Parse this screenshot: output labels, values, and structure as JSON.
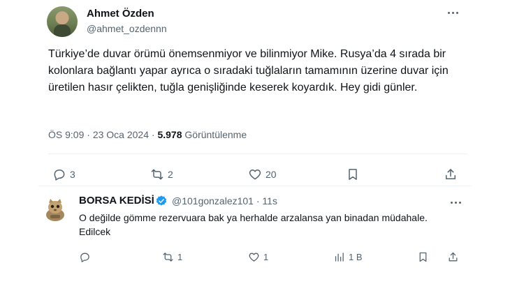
{
  "tweet": {
    "author_name": "Ahmet Özden",
    "author_handle": "@ahmet_ozdennn",
    "text": "Türkiye’de duvar örümü önemsenmiyor ve bilinmiyor Mike. Rusya’da 4 sırada bir kolonlara bağlantı yapar ayrıca o sıradaki tuğlaların tamamının üzerine duvar için üretilen hasır çelikten, tuğla genişliğinde keserek koyardık. Hey gidi günler.",
    "time": "ÖS 9:09",
    "separator": "·",
    "date": "23 Oca 2024",
    "views_count": "5.978",
    "views_label": "Görüntülenme",
    "actions": {
      "replies": "3",
      "retweets": "2",
      "likes": "20"
    }
  },
  "reply": {
    "author_name": "BORSA KEDİSİ",
    "author_handle": "@101gonzalez101 · 11s",
    "text": "O değilde gömme rezervuara bak ya herhalde arzalansa yan binadan müdahale. Edilcek",
    "actions": {
      "retweets": "1",
      "likes": "1",
      "views": "1 B"
    }
  },
  "colors": {
    "text": "#0f1419",
    "secondary": "#536471",
    "verified": "#1d9bf0",
    "divider": "#eff3f4"
  },
  "icons": [
    "more-icon",
    "reply-icon",
    "retweet-icon",
    "like-icon",
    "bookmark-icon",
    "share-icon",
    "views-icon",
    "verified-badge-icon"
  ]
}
